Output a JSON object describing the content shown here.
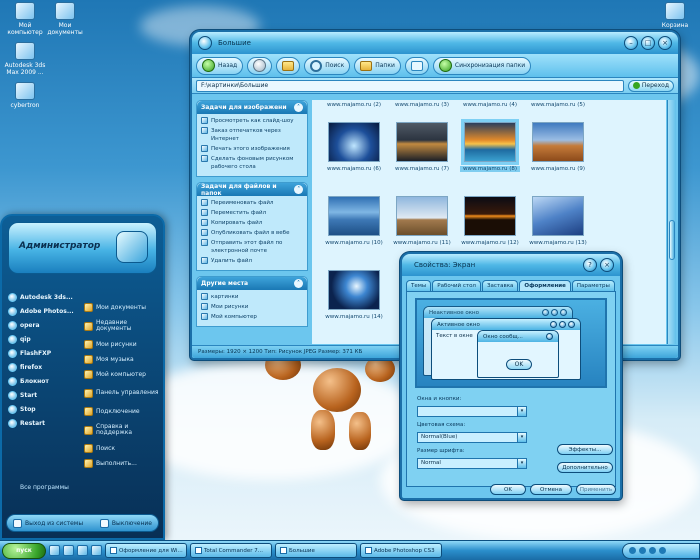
{
  "desktop": {
    "icons": [
      {
        "label": "Мой компьютер"
      },
      {
        "label": "Мои документы"
      },
      {
        "label": "Autodesk 3ds Max 2009 ..."
      },
      {
        "label": "cybertron"
      },
      {
        "label": "Корзина"
      }
    ]
  },
  "explorer": {
    "title": "Большие",
    "toolbar": {
      "back": "Назад",
      "search": "Поиск",
      "folders": "Папки",
      "sync": "Синхронизация папки"
    },
    "address": "F:\\картинки\\Большие",
    "go": "Переход",
    "panels": [
      {
        "title": "Задачи для изображени",
        "items": [
          "Просмотреть как слайд-шоу",
          "Заказ отпечатков через Интернет",
          "Печать этого изображения",
          "Сделать фоновым рисунком рабочего стола"
        ]
      },
      {
        "title": "Задачи для файлов и папок",
        "items": [
          "Переименовать файл",
          "Переместить файл",
          "Копировать файл",
          "Опубликовать файл в вебе",
          "Отправить этот файл по электронной почте",
          "Удалить файл"
        ]
      },
      {
        "title": "Другие места",
        "items": [
          "картинки",
          "Мои рисунки",
          "Мой компьютер"
        ]
      }
    ],
    "thumbnails": [
      {
        "caption": "www.majamo.ru (2)"
      },
      {
        "caption": "www.majamo.ru (3)"
      },
      {
        "caption": "www.majamo.ru (4)"
      },
      {
        "caption": "www.majamo.ru (5)"
      },
      {
        "caption": "www.majamo.ru (6)"
      },
      {
        "caption": "www.majamo.ru (7)"
      },
      {
        "caption": "www.majamo.ru (8)"
      },
      {
        "caption": "www.majamo.ru (9)"
      },
      {
        "caption": "www.majamo.ru (10)"
      },
      {
        "caption": "www.majamo.ru (11)"
      },
      {
        "caption": "www.majamo.ru (12)"
      },
      {
        "caption": "www.majamo.ru (13)"
      },
      {
        "caption": "www.majamo.ru (14)"
      }
    ],
    "status": "Размеры: 1920 × 1200 Тип: Рисунок JPEG Размер: 371 КБ"
  },
  "start_menu": {
    "user": "Администратор",
    "left_items": [
      "Autodesk 3ds...",
      "Adobe Photos...",
      "opera",
      "qip",
      "FlashFXP",
      "firefox",
      "Блокнот",
      "Start",
      "Stop",
      "Restart"
    ],
    "right_items": [
      "Мои документы",
      "Недавние документы",
      "Мои рисунки",
      "Моя музыка",
      "Мой компьютер",
      "Панель управления",
      "Подключение",
      "Справка и поддержка",
      "Поиск",
      "Выполнить..."
    ],
    "all_programs": "Все программы",
    "logoff": "Выход из системы",
    "shutdown": "Выключение"
  },
  "dialog": {
    "title": "Свойства: Экран",
    "tabs": [
      "Темы",
      "Рабочий стол",
      "Заставка",
      "Оформление",
      "Параметры"
    ],
    "active_tab": "Оформление",
    "preview": {
      "inactive": "Неактивное окно",
      "active": "Активное окно",
      "text": "Текст в окне",
      "msgbox": "Окно сообщ...",
      "ok": "OK"
    },
    "fields": [
      {
        "label": "Окна и кнопки:",
        "value": ""
      },
      {
        "label": "Цветовая схема:",
        "value": "Normal(Blue)"
      },
      {
        "label": "Размер шрифта:",
        "value": "Normal"
      }
    ],
    "effects": "Эффекты...",
    "advanced": "Дополнительно",
    "ok": "OK",
    "cancel": "Отмена",
    "apply": "Применить"
  },
  "taskbar": {
    "start": "пуск",
    "tasks": [
      "Оформление для Wi...",
      "Total Commander 7...",
      "Большие",
      "Adobe Photoshop CS3"
    ]
  }
}
